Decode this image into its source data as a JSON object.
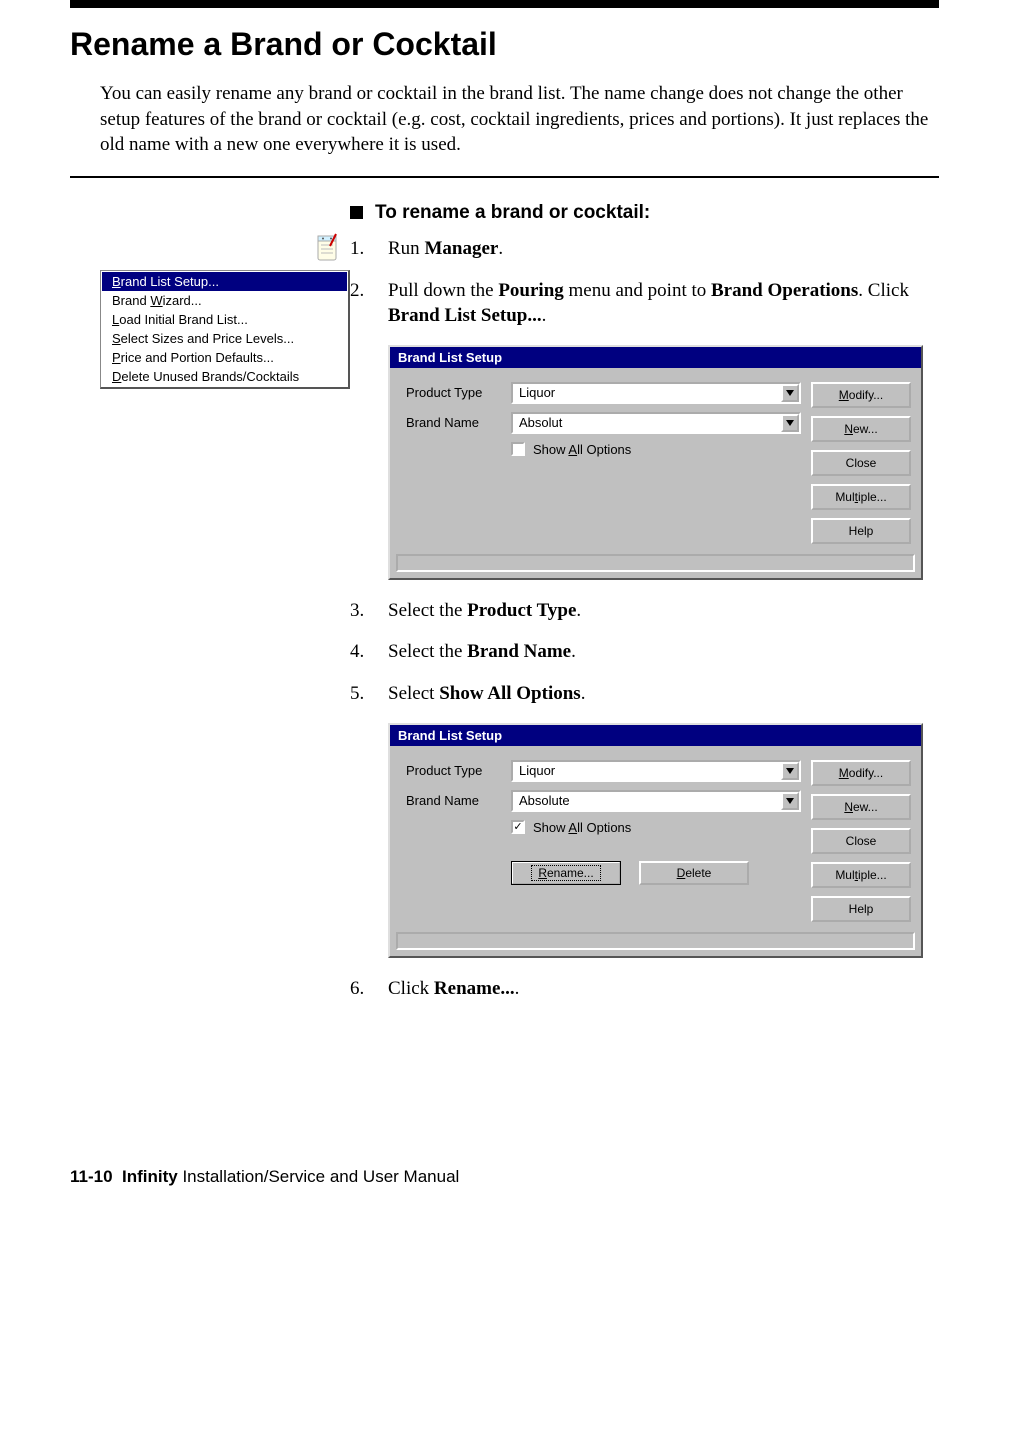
{
  "header": {
    "section_title": "Rename a Brand or Cocktail",
    "intro": "You can easily rename any brand or cocktail in the brand list. The name change does not change the other setup features of the brand or cocktail (e.g. cost, cocktail ingredients, prices and portions). It just replaces the old name with a new one everywhere it is used."
  },
  "task_heading": "To rename a brand or cocktail:",
  "menu": {
    "items": [
      {
        "pre": "",
        "ul": "B",
        "post": "rand List Setup...",
        "selected": true
      },
      {
        "pre": "Brand ",
        "ul": "W",
        "post": "izard...",
        "selected": false
      },
      {
        "pre": "",
        "ul": "L",
        "post": "oad Initial Brand List...",
        "selected": false
      },
      {
        "pre": "",
        "ul": "S",
        "post": "elect Sizes and Price Levels...",
        "selected": false
      },
      {
        "pre": "",
        "ul": "P",
        "post": "rice and Portion Defaults...",
        "selected": false
      },
      {
        "pre": "",
        "ul": "D",
        "post": "elete Unused Brands/Cocktails",
        "selected": false
      }
    ]
  },
  "steps": {
    "s1_num": "1.",
    "s1_a": "Run ",
    "s1_b": "Manager",
    "s1_c": ".",
    "s2_num": "2.",
    "s2_a": "Pull down the ",
    "s2_b": "Pouring",
    "s2_c": " menu and point to ",
    "s2_d": "Brand Operations",
    "s2_e": ". Click ",
    "s2_f": "Brand List Setup...",
    "s2_g": ".",
    "s3_num": "3.",
    "s3_a": "Select the ",
    "s3_b": "Product Type",
    "s3_c": ".",
    "s4_num": "4.",
    "s4_a": "Select the ",
    "s4_b": "Brand Name",
    "s4_c": ".",
    "s5_num": "5.",
    "s5_a": "Select ",
    "s5_b": "Show All Options",
    "s5_c": ".",
    "s6_num": "6.",
    "s6_a": "Click ",
    "s6_b": "Rename...",
    "s6_c": "."
  },
  "dialog1": {
    "title": "Brand List Setup",
    "product_type_label": "Product Type",
    "product_type_value": "Liquor",
    "brand_name_label": "Brand Name",
    "brand_name_value": "Absolut",
    "show_all_pre": "Show ",
    "show_all_ul": "A",
    "show_all_post": "ll Options",
    "show_all_checked": false,
    "buttons": {
      "modify_ul": "M",
      "modify_post": "odify...",
      "new_ul": "N",
      "new_post": "ew...",
      "close": "Close",
      "multiple_pre": "Mul",
      "multiple_ul": "t",
      "multiple_post": "iple...",
      "help": "Help"
    }
  },
  "dialog2": {
    "title": "Brand List Setup",
    "product_type_label": "Product Type",
    "product_type_value": "Liquor",
    "brand_name_label": "Brand Name",
    "brand_name_value": "Absolute",
    "show_all_pre": "Show ",
    "show_all_ul": "A",
    "show_all_post": "ll Options",
    "show_all_checked": true,
    "extra": {
      "rename_ul": "R",
      "rename_post": "ename...",
      "delete_ul": "D",
      "delete_post": "elete"
    },
    "buttons": {
      "modify_ul": "M",
      "modify_post": "odify...",
      "new_ul": "N",
      "new_post": "ew...",
      "close": "Close",
      "multiple_pre": "Mul",
      "multiple_ul": "t",
      "multiple_post": "iple...",
      "help": "Help"
    }
  },
  "footer": {
    "page_number": "11-10",
    "manual_title_bold": "Infinity",
    "manual_title_rest": " Installation/Service and User Manual"
  }
}
